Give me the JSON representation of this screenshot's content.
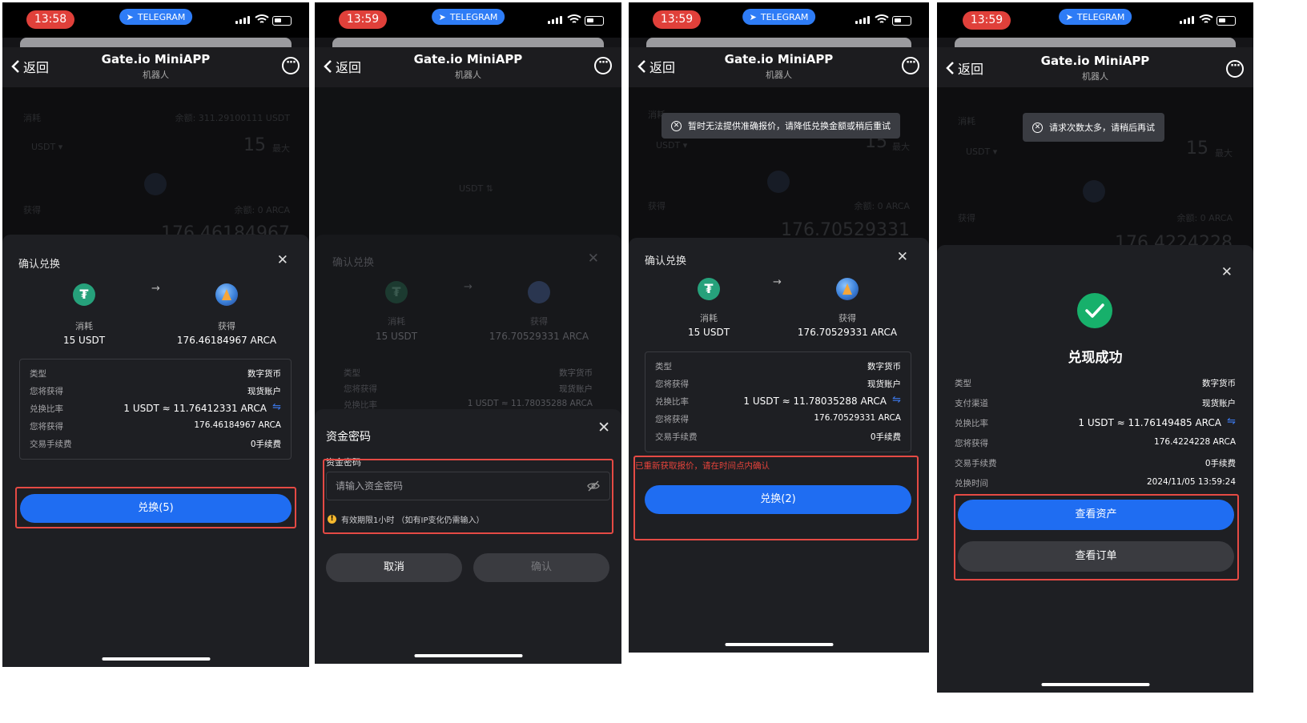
{
  "status_bar": [
    {
      "time": "13:58",
      "telegram": "TELEGRAM"
    },
    {
      "time": "13:59",
      "telegram": "TELEGRAM"
    },
    {
      "time": "13:59",
      "telegram": "TELEGRAM"
    },
    {
      "time": "13:59",
      "telegram": "TELEGRAM"
    }
  ],
  "nav": {
    "back": "返回",
    "title": "Gate.io MiniAPP",
    "subtitle": "机器人"
  },
  "background": {
    "consume": "消耗",
    "balance1": "余额: 311.29100111 USDT",
    "coin": "USDT ▾",
    "amount": "15",
    "max": "最大",
    "receive": "获得",
    "balance2": "余额: 0 ARCA",
    "received1": "176.46184967",
    "received3": "176.70529331",
    "received4": "176.4224228"
  },
  "screen1": {
    "title": "确认兑换",
    "consume_label": "消耗",
    "consume_value": "15 USDT",
    "receive_label": "获得",
    "receive_value": "176.46184967 ARCA",
    "rows": [
      {
        "k": "类型",
        "v": "数字货币"
      },
      {
        "k": "您将获得",
        "v": "现货账户"
      },
      {
        "k": "兑换比率",
        "v": "1 USDT ≈ 11.76412331 ARCA"
      },
      {
        "k": "您将获得",
        "v": "176.46184967 ARCA"
      },
      {
        "k": "交易手续费",
        "v": "0手续费"
      }
    ],
    "button": "兑换(5)"
  },
  "screen2": {
    "bg_title": "确认兑换",
    "bg_consume": "消耗",
    "bg_consume_value": "15 USDT",
    "bg_receive": "获得",
    "bg_receive_value": "176.70529331 ARCA",
    "bg_rows": [
      {
        "k": "类型",
        "v": "数字货币"
      },
      {
        "k": "您将获得",
        "v": "现货账户"
      },
      {
        "k": "兑换比率",
        "v": "1 USDT ≈ 11.78035288 ARCA"
      }
    ],
    "title": "资金密码",
    "field_label": "资金密码",
    "placeholder": "请输入资金密码",
    "note": "有效期限1小时 （如有IP变化仍需输入）",
    "cancel": "取消",
    "confirm": "确认"
  },
  "screen3": {
    "toast": "暂时无法提供准确报价，请降低兑换金额或稍后重试",
    "title": "确认兑换",
    "consume_label": "消耗",
    "consume_value": "15 USDT",
    "receive_label": "获得",
    "receive_value": "176.70529331 ARCA",
    "rows": [
      {
        "k": "类型",
        "v": "数字货币"
      },
      {
        "k": "您将获得",
        "v": "现货账户"
      },
      {
        "k": "兑换比率",
        "v": "1 USDT ≈ 11.78035288 ARCA"
      },
      {
        "k": "您将获得",
        "v": "176.70529331 ARCA"
      },
      {
        "k": "交易手续费",
        "v": "0手续费"
      }
    ],
    "warning": "已重新获取报价，请在时间点内确认",
    "button": "兑换(2)"
  },
  "screen4": {
    "toast": "请求次数太多，请稍后再试",
    "success": "兑现成功",
    "rows": [
      {
        "k": "类型",
        "v": "数字货币"
      },
      {
        "k": "支付渠道",
        "v": "现货账户"
      },
      {
        "k": "兑换比率",
        "v": "1 USDT ≈ 11.76149485 ARCA"
      },
      {
        "k": "您将获得",
        "v": "176.4224228 ARCA"
      },
      {
        "k": "交易手续费",
        "v": "0手续费"
      },
      {
        "k": "兑换时间",
        "v": "2024/11/05 13:59:24"
      }
    ],
    "view_assets": "查看资产",
    "view_orders": "查看订单"
  }
}
